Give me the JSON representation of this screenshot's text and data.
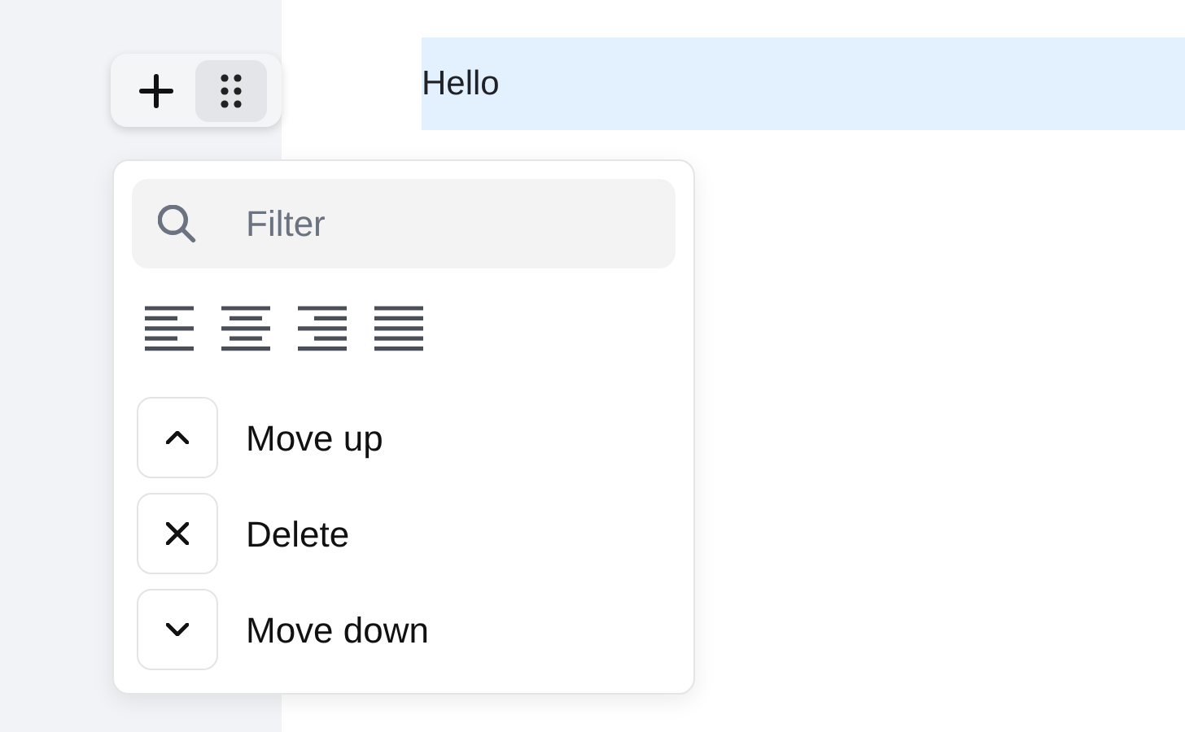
{
  "block": {
    "text": "Hello",
    "selected": true
  },
  "toolbar": {
    "buttons": [
      {
        "kind": "add",
        "hovered": false
      },
      {
        "kind": "drag",
        "hovered": true
      }
    ]
  },
  "menu": {
    "filter": {
      "placeholder": "Filter"
    },
    "alignments": [
      {
        "kind": "left"
      },
      {
        "kind": "center"
      },
      {
        "kind": "right"
      },
      {
        "kind": "justify"
      }
    ],
    "actions": [
      {
        "kind": "up",
        "label": "Move up"
      },
      {
        "kind": "delete",
        "label": "Delete"
      },
      {
        "kind": "down",
        "label": "Move down"
      }
    ]
  }
}
